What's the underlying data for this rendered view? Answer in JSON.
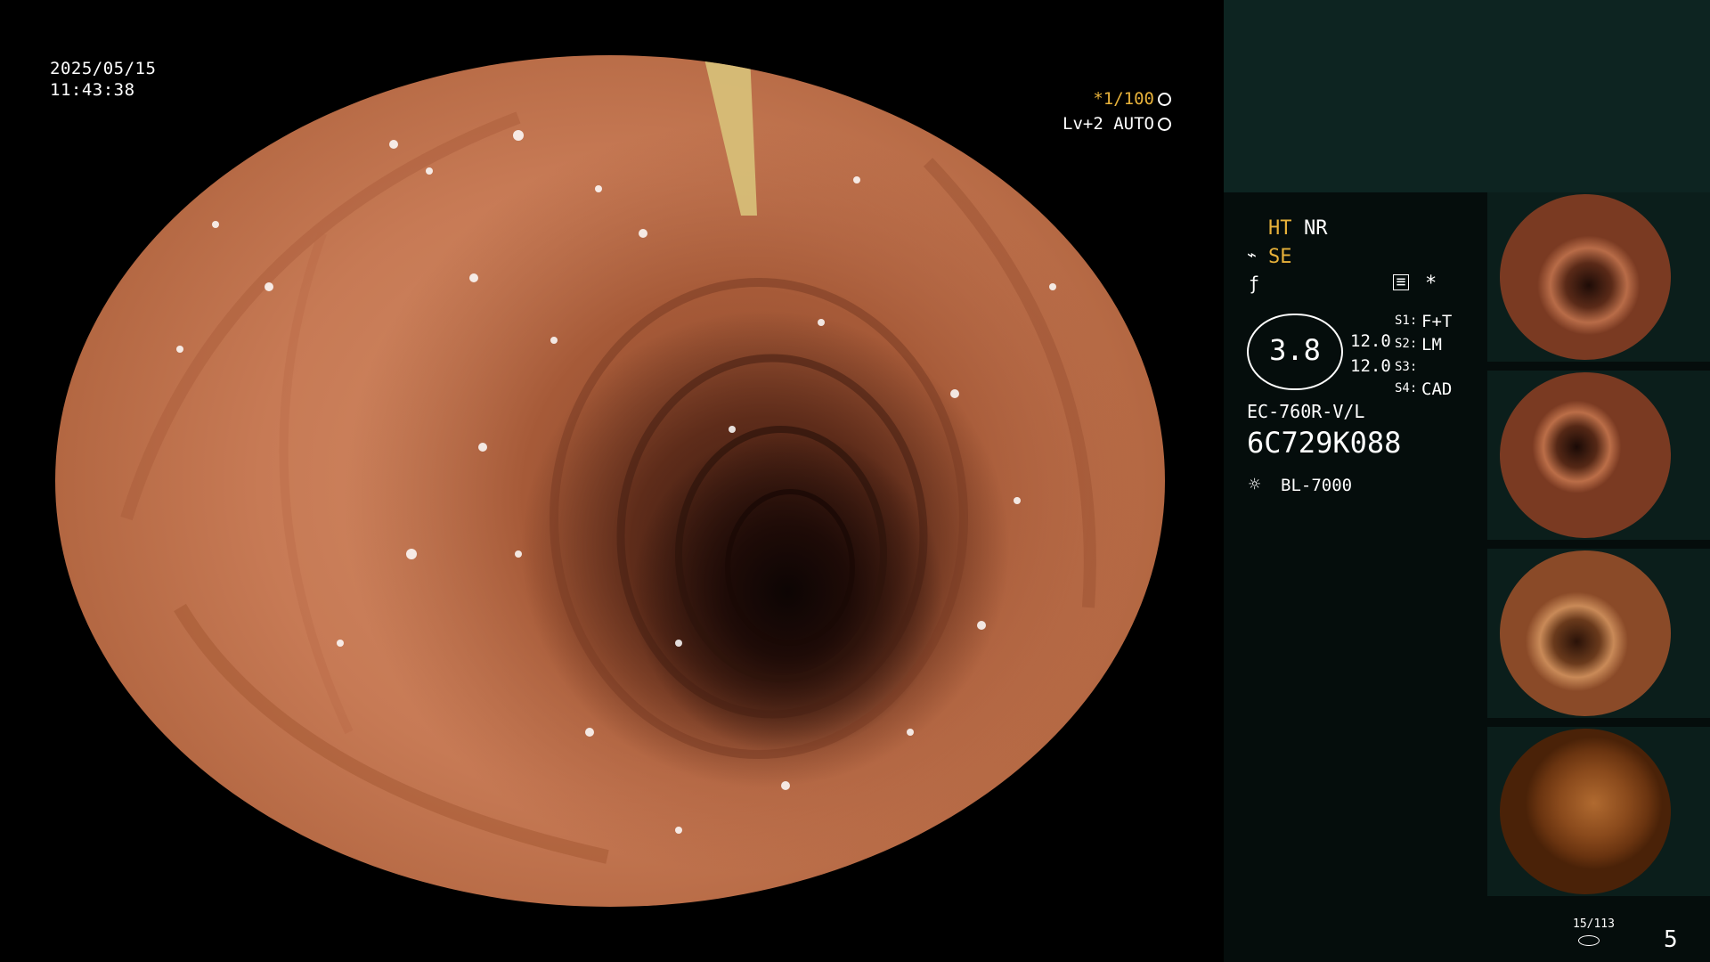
{
  "overlay": {
    "date": "2025/05/15",
    "time": "11:43:38",
    "shutter": "*1/100",
    "level": "Lv+2 AUTO"
  },
  "panel": {
    "ht": "HT",
    "nr": "NR",
    "se": "SE",
    "gauge_value": "3.8",
    "setting_a": "12.0",
    "setting_b": "12.0",
    "s1_key": "S1:",
    "s1_val": "F+T",
    "s2_key": "S2:",
    "s2_val": "LM",
    "s3_key": "S3:",
    "s3_val": "",
    "s4_key": "S4:",
    "s4_val": "CAD",
    "asterisk": "*",
    "scope_model": "EC-760R-V/L",
    "serial": "6C729K088",
    "light_source": "BL-7000",
    "counter": "15/113",
    "page_number": "5"
  },
  "thumbnails": [
    {
      "id": "thumb-1"
    },
    {
      "id": "thumb-2"
    },
    {
      "id": "thumb-3"
    },
    {
      "id": "thumb-4"
    }
  ],
  "colors": {
    "accent_yellow": "#e8b23a",
    "panel_top": "#0d2421",
    "panel_bottom": "#050d0c",
    "mucosa": "#c77a55"
  },
  "icons": {
    "wb": "snowflake-wheel-icon",
    "auto": "iris-icon",
    "enhance": "enhance-icon",
    "sharp": "sharpness-icon",
    "record": "record-icon",
    "lamp": "light-bulb-icon",
    "storage": "storage-disk-icon"
  }
}
